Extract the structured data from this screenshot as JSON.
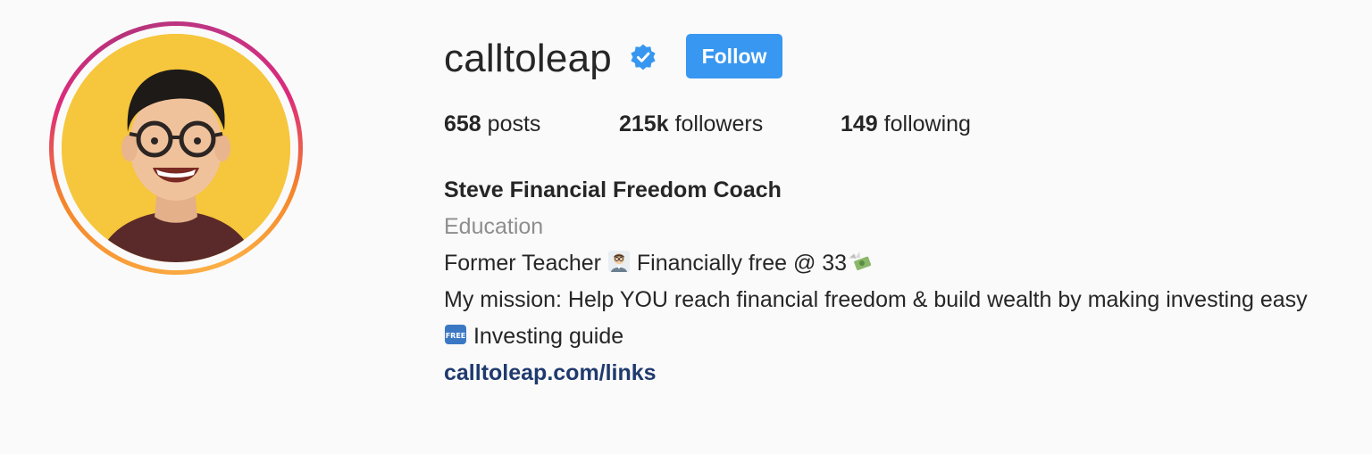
{
  "profile": {
    "username": "calltoleap",
    "verified": true,
    "follow_label": "Follow",
    "accent_color": "#3897f0",
    "avatar_icon": "profile-photo"
  },
  "stats": {
    "posts_count": "658",
    "posts_label": " posts",
    "followers_count": "215k",
    "followers_label": " followers",
    "following_count": "149",
    "following_label": " following"
  },
  "bio": {
    "name": "Steve Financial Freedom Coach",
    "category": "Education",
    "line1_a": "Former Teacher ",
    "line1_icon": "teacher-emoji",
    "line1_b": " Financially free @ 33",
    "line1_icon2": "money-with-wings-emoji",
    "line2": "My mission: Help YOU reach financial freedom & build wealth by making investing easy",
    "line3_icon": "free-button-emoji",
    "line3": " Investing guide",
    "link": "calltoleap.com/links"
  }
}
